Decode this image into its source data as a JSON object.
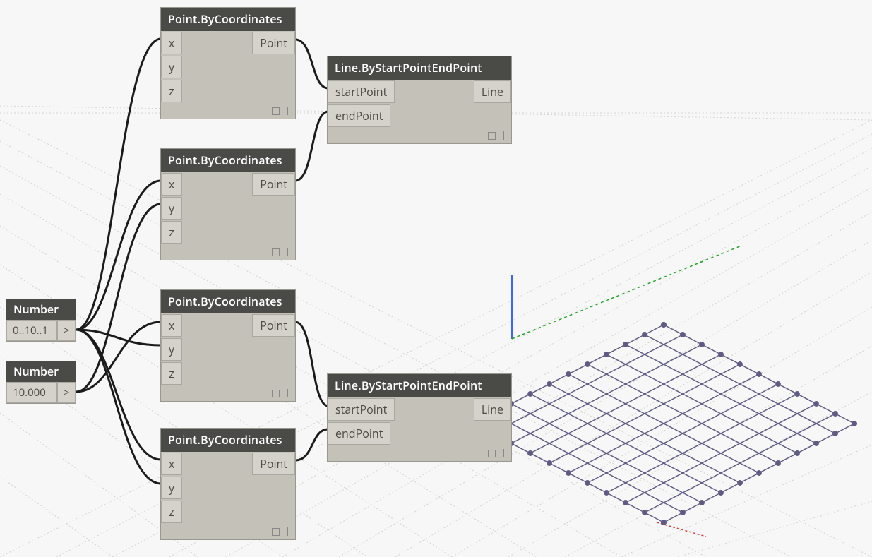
{
  "nodes": {
    "number1": {
      "title": "Number",
      "value": "0..10..1",
      "chev": ">"
    },
    "number2": {
      "title": "Number",
      "value": "10.000",
      "chev": ">"
    },
    "pbc1": {
      "title": "Point.ByCoordinates",
      "x": "x",
      "y": "y",
      "z": "z",
      "out": "Point"
    },
    "pbc2": {
      "title": "Point.ByCoordinates",
      "x": "x",
      "y": "y",
      "z": "z",
      "out": "Point"
    },
    "pbc3": {
      "title": "Point.ByCoordinates",
      "x": "x",
      "y": "y",
      "z": "z",
      "out": "Point"
    },
    "pbc4": {
      "title": "Point.ByCoordinates",
      "x": "x",
      "y": "y",
      "z": "z",
      "out": "Point"
    },
    "line1": {
      "title": "Line.ByStartPointEndPoint",
      "sp": "startPoint",
      "ep": "endPoint",
      "out": "Line"
    },
    "line2": {
      "title": "Line.ByStartPointEndPoint",
      "sp": "startPoint",
      "ep": "endPoint",
      "out": "Line"
    }
  }
}
